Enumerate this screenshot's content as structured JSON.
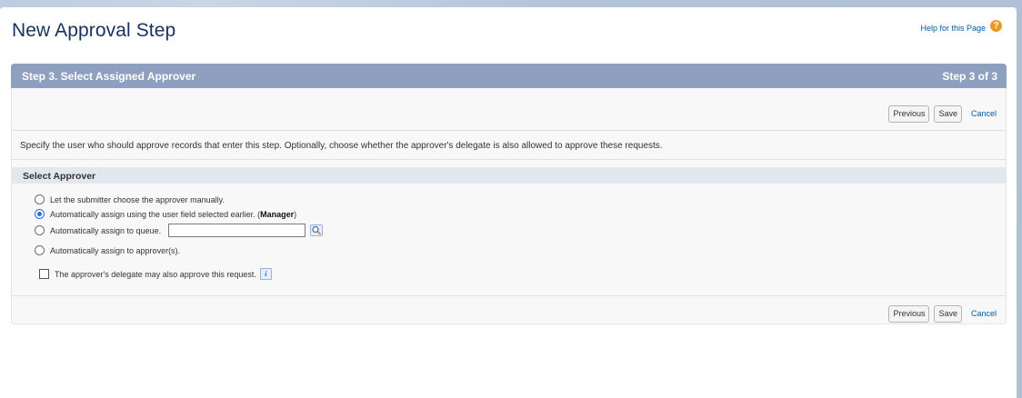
{
  "page": {
    "title": "New Approval Step",
    "help_link": "Help for this Page",
    "help_icon_glyph": "?"
  },
  "step": {
    "header": "Step 3. Select Assigned Approver",
    "counter": "Step 3 of 3"
  },
  "buttons": {
    "previous": "Previous",
    "save": "Save",
    "cancel": "Cancel"
  },
  "description": "Specify the user who should approve records that enter this step. Optionally, choose whether the approver's delegate is also allowed to approve these requests.",
  "select_approver": {
    "heading": "Select Approver",
    "options": [
      {
        "label": "Let the submitter choose the approver manually.",
        "selected": false
      },
      {
        "label": "Automatically assign using the user field selected earlier. (",
        "emphasis": "Manager",
        "suffix": ")",
        "selected": true
      },
      {
        "label": "Automatically assign to queue.",
        "selected": false,
        "input_value": ""
      },
      {
        "label": "Automatically assign to approver(s).",
        "selected": false
      }
    ],
    "delegate": {
      "label": "The approver's delegate may also approve this request.",
      "checked": false,
      "info_glyph": "i"
    }
  },
  "colors": {
    "header_bg": "#8e9fbf",
    "link": "#015ba7",
    "help_icon": "#e89a25",
    "radio_selected": "#2b6fd6"
  }
}
